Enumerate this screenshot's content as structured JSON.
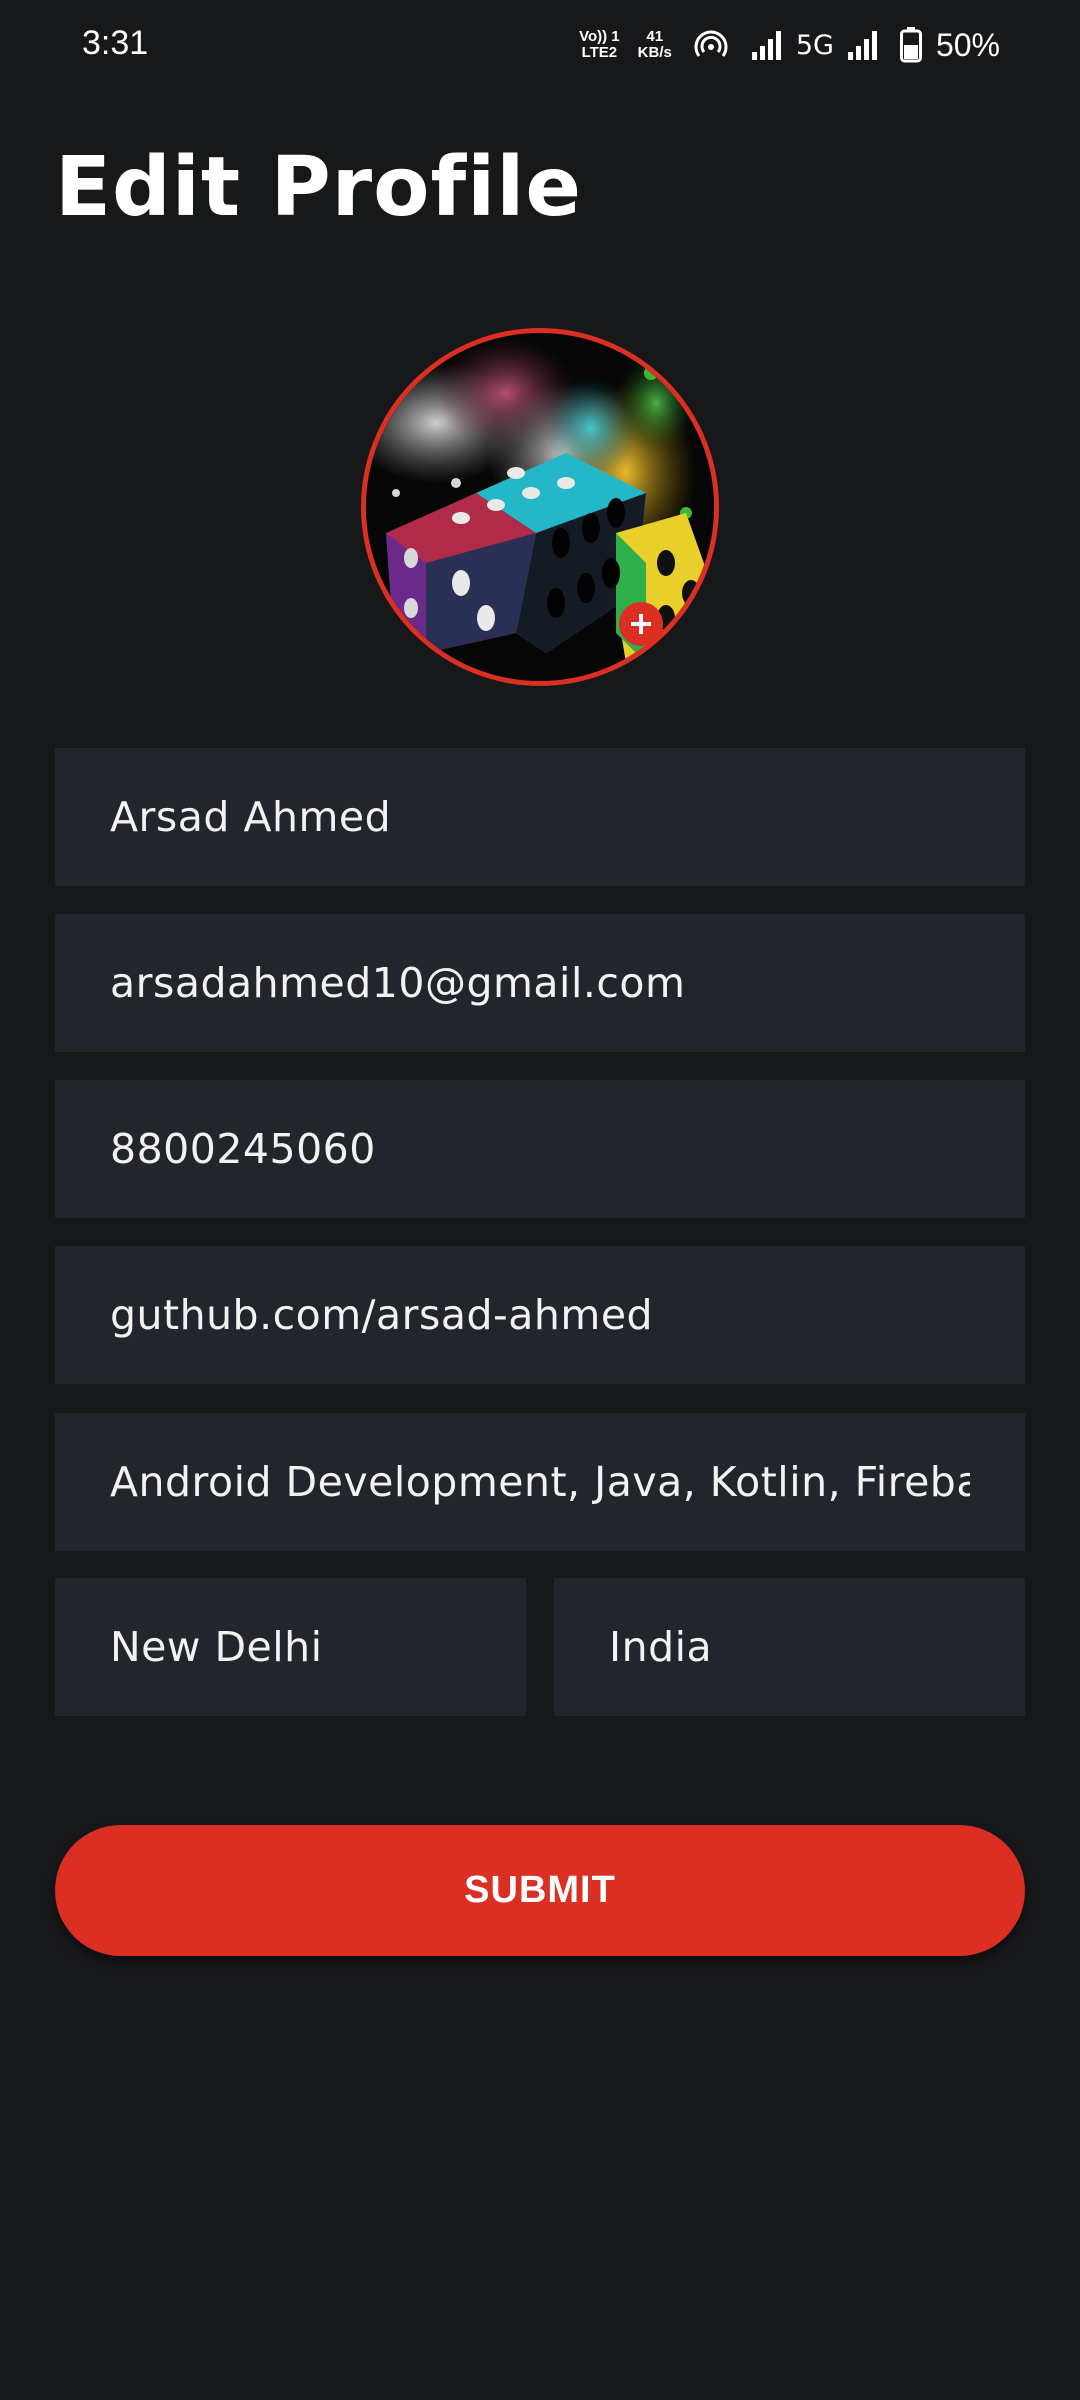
{
  "status_bar": {
    "time": "3:31",
    "volte_top": "Vo)) 1",
    "volte_bottom": "LTE2",
    "speed_value": "41",
    "speed_unit": "KB/s",
    "network": "5G",
    "battery": "50%",
    "icons": [
      "volte-icon",
      "hotspot-icon",
      "signal-icon",
      "signal-icon",
      "battery-icon"
    ]
  },
  "header": {
    "title": "Edit Profile"
  },
  "profile": {
    "avatar_icon": "dice-splash-photo",
    "add_photo_icon": "plus-icon"
  },
  "form": {
    "name": "Arsad Ahmed",
    "email": "arsadahmed10@gmail.com",
    "phone": "8800245060",
    "github": "guthub.com/arsad-ahmed",
    "skills": "Android Development, Java, Kotlin, Firebase",
    "city": "New Delhi",
    "country": "India"
  },
  "actions": {
    "submit_label": "SUBMIT"
  },
  "colors": {
    "background": "#17181a",
    "field_background": "#23252d",
    "accent": "#dc2f23",
    "text": "#ffffff"
  }
}
